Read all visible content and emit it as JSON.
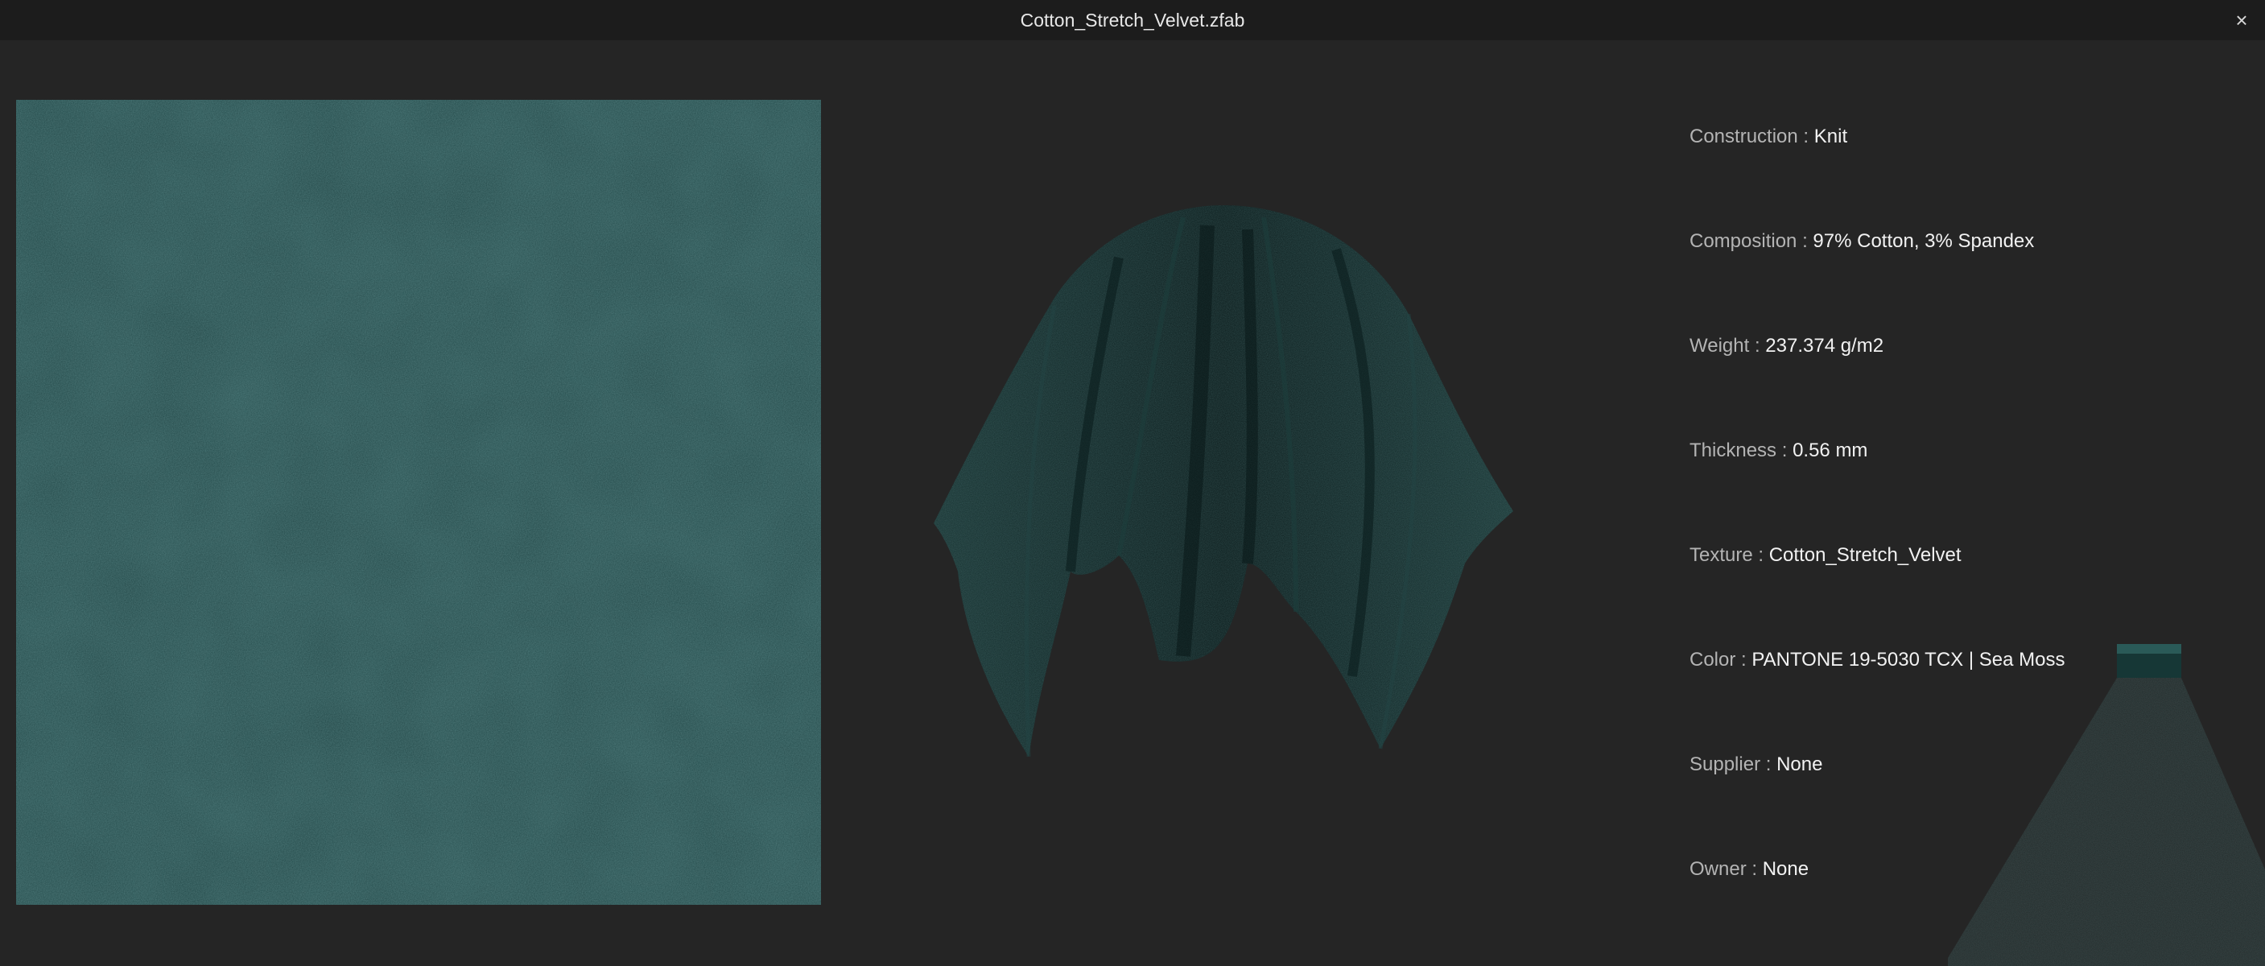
{
  "window": {
    "title": "Cotton_Stretch_Velvet.zfab",
    "close_glyph": "×"
  },
  "colors": {
    "background": "#252525",
    "titlebar": "#1c1c1c",
    "fabric_swatch": "#1f4444",
    "fabric_drape": "#0f2626",
    "label_text": "#b4b4b4",
    "value_text": "#f2f2f2"
  },
  "icons": {
    "close": "close-icon"
  },
  "properties": [
    {
      "key": "construction",
      "label": "Construction",
      "sep": ":",
      "value": "Knit"
    },
    {
      "key": "composition",
      "label": "Composition",
      "sep": ":",
      "value": "97% Cotton, 3% Spandex"
    },
    {
      "key": "weight",
      "label": "Weight",
      "sep": ":",
      "value": "237.374 g/m2"
    },
    {
      "key": "thickness",
      "label": "Thickness",
      "sep": ":",
      "value": "0.56 mm"
    },
    {
      "key": "texture",
      "label": "Texture",
      "sep": ":",
      "value": "Cotton_Stretch_Velvet"
    },
    {
      "key": "color",
      "label": "Color",
      "sep": ":",
      "value": "PANTONE 19-5030 TCX | Sea Moss"
    },
    {
      "key": "supplier",
      "label": "Supplier",
      "sep": ":",
      "value": "None"
    },
    {
      "key": "owner",
      "label": "Owner",
      "sep": ":",
      "value": "None"
    }
  ]
}
